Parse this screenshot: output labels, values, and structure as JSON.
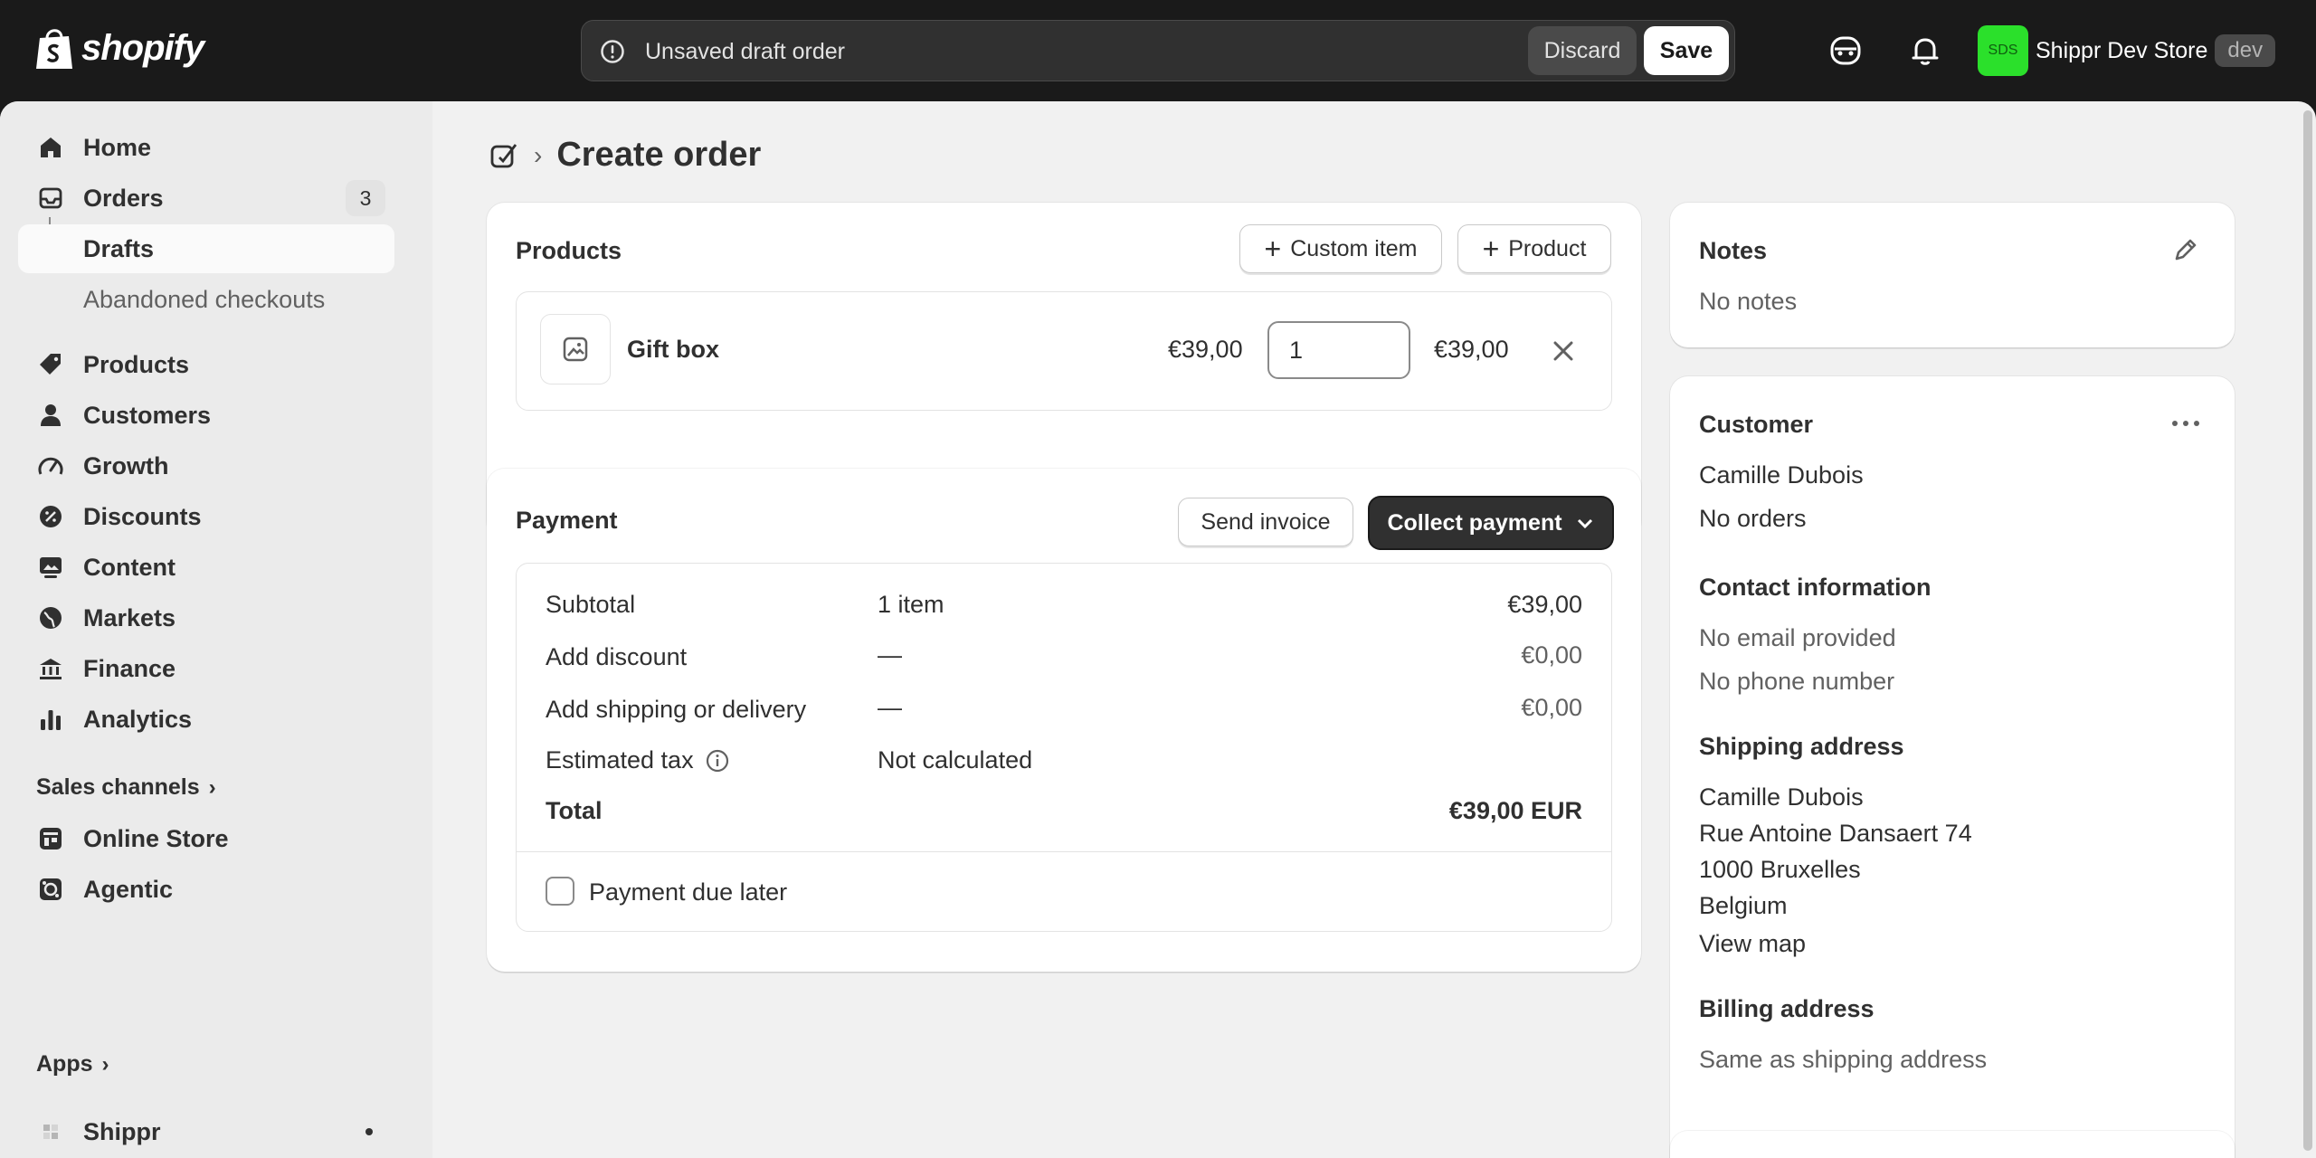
{
  "topbar": {
    "brand": "shopify",
    "draft_message": "Unsaved draft order",
    "discard_label": "Discard",
    "save_label": "Save",
    "store_initials": "SDS",
    "store_name": "Shippr Dev Store",
    "store_badge": "dev"
  },
  "sidebar": {
    "home": "Home",
    "orders": "Orders",
    "orders_count": "3",
    "drafts": "Drafts",
    "abandoned": "Abandoned checkouts",
    "products": "Products",
    "customers": "Customers",
    "growth": "Growth",
    "discounts": "Discounts",
    "content": "Content",
    "markets": "Markets",
    "finance": "Finance",
    "analytics": "Analytics",
    "sales_channels": "Sales channels",
    "online_store": "Online Store",
    "agentic": "Agentic",
    "apps": "Apps",
    "shippr": "Shippr"
  },
  "page": {
    "title": "Create order"
  },
  "products_card": {
    "title": "Products",
    "custom_item_label": "Custom item",
    "product_label": "Product",
    "line_item": {
      "name": "Gift box",
      "unit_price": "€39,00",
      "quantity": "1",
      "total": "€39,00"
    }
  },
  "payment_card": {
    "title": "Payment",
    "send_invoice_label": "Send invoice",
    "collect_payment_label": "Collect payment",
    "rows": {
      "subtotal_label": "Subtotal",
      "subtotal_middle": "1 item",
      "subtotal_value": "€39,00",
      "discount_label": "Add discount",
      "discount_middle": "—",
      "discount_value": "€0,00",
      "shipping_label": "Add shipping or delivery",
      "shipping_middle": "—",
      "shipping_value": "€0,00",
      "tax_label": "Estimated tax",
      "tax_middle": "Not calculated",
      "total_label": "Total",
      "total_value": "€39,00 EUR"
    },
    "payment_due_later_label": "Payment due later"
  },
  "notes_card": {
    "title": "Notes",
    "value": "No notes"
  },
  "customer_card": {
    "title": "Customer",
    "name": "Camille Dubois",
    "orders": "No orders",
    "contact_title": "Contact information",
    "email": "No email provided",
    "phone": "No phone number",
    "shipping_title": "Shipping address",
    "shipping_lines": [
      "Camille Dubois",
      "Rue Antoine Dansaert 74",
      "1000 Bruxelles",
      "Belgium"
    ],
    "view_map": "View map",
    "billing_title": "Billing address",
    "billing_value": "Same as shipping address"
  },
  "colors": {
    "brand_green": "#2be02b",
    "link": "#005bd3",
    "topbar": "#1a1a1a"
  }
}
